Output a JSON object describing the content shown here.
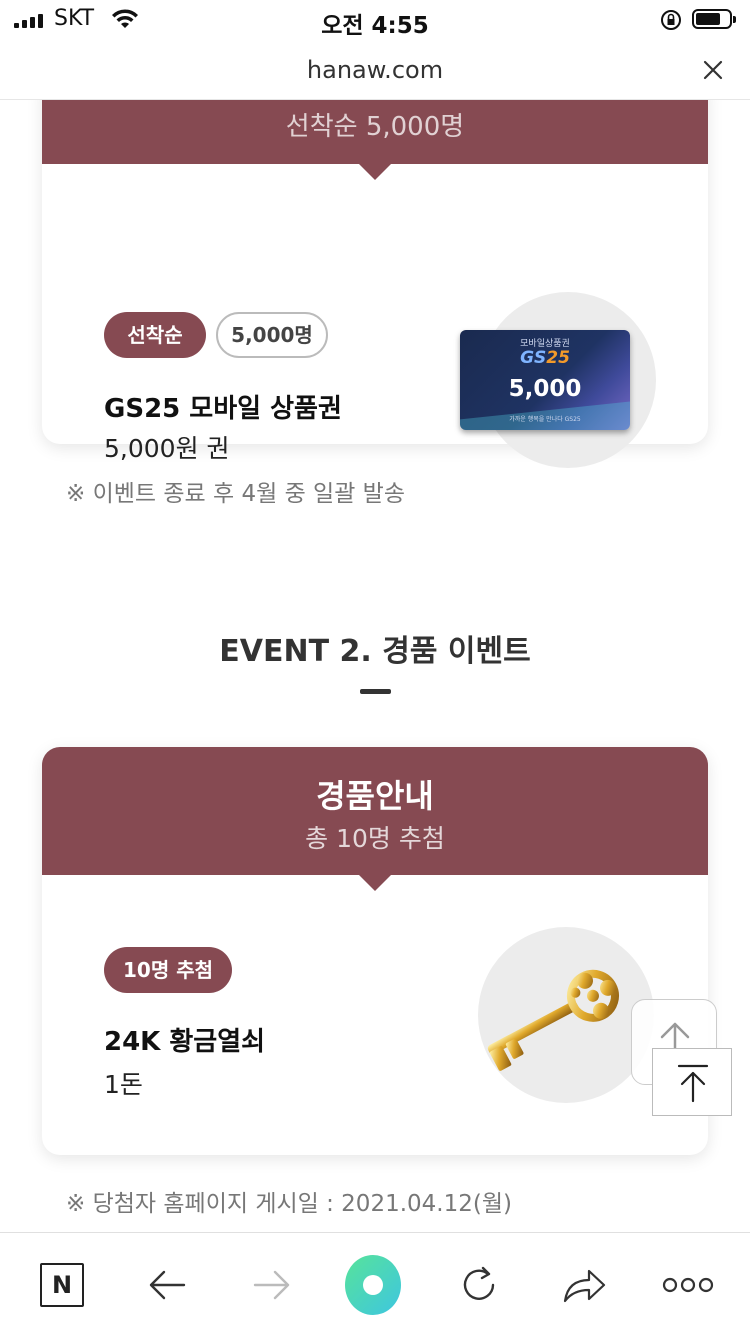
{
  "status_bar": {
    "carrier": "SKT",
    "time": "오전 4:55"
  },
  "browser": {
    "url": "hanaw.com"
  },
  "prize1": {
    "head_text": "선착순 5,000명",
    "chip_primary": "선착순",
    "chip_secondary": "5,000명",
    "name": "GS25 모바일 상품권",
    "desc": "5,000원 권",
    "gift_card": {
      "top_text": "모바일상품권",
      "logo_gs": "GS",
      "logo_25": "25",
      "amount": "5,000",
      "footer": "가까운 행복을 만나다 GS25"
    }
  },
  "note1": "※ 이벤트 종료 후 4월 중 일괄 발송",
  "event2": {
    "title": "EVENT 2. 경품 이벤트"
  },
  "prize2": {
    "head_title": "경품안내",
    "head_sub": "총 10명 추첨",
    "chip": "10명 추첨",
    "name": "24K 황금열쇠",
    "desc": "1돈"
  },
  "note2": "※ 당첨자 홈페이지 게시일 : 2021.04.12(월)",
  "toolbar": {
    "naver_label": "N"
  },
  "colors": {
    "accent": "#864a52"
  },
  "icons": [
    "signal-icon",
    "wifi-icon",
    "rotation-lock-icon",
    "battery-icon",
    "close-icon",
    "naver-icon",
    "back-icon",
    "forward-icon",
    "home-icon",
    "reload-icon",
    "share-icon",
    "more-icon",
    "scroll-top-icon",
    "key-icon"
  ]
}
